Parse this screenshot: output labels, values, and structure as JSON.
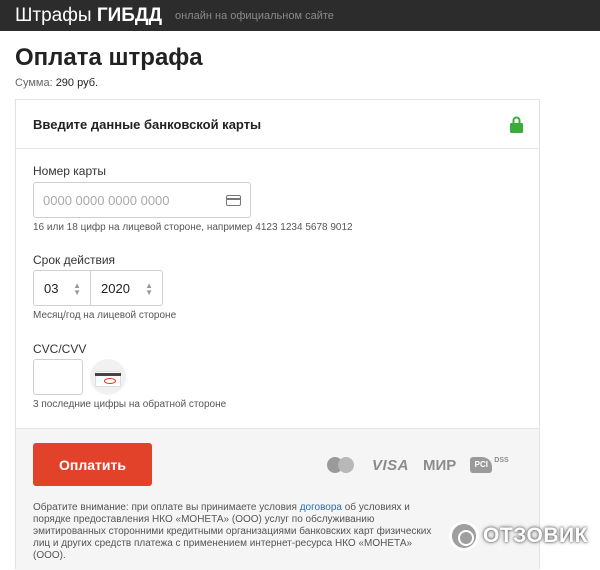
{
  "topbar": {
    "brand_light": "Штрафы",
    "brand_bold": "ГИБДД",
    "tagline": "онлайн на официальном сайте"
  },
  "page": {
    "title": "Оплата штрафа",
    "sum_label": "Сумма:",
    "sum_value": "290 руб."
  },
  "card_form": {
    "header": "Введите данные банковской карты",
    "lock_icon": "lock-icon",
    "card_number": {
      "label": "Номер карты",
      "placeholder": "0000 0000 0000 0000",
      "hint": "16 или 18 цифр на лицевой стороне, например 4123 1234 5678 9012"
    },
    "expiry": {
      "label": "Срок действия",
      "month": "03",
      "year": "2020",
      "hint": "Месяц/год на лицевой стороне"
    },
    "cvc": {
      "label": "CVC/CVV",
      "hint": "3 последние цифры на обратной стороне"
    }
  },
  "payment": {
    "pay_button": "Оплатить",
    "logos": {
      "visa": "VISA",
      "mir": "МИР",
      "pci": "PCI",
      "dss": "DSS"
    },
    "notice_before": "Обратите внимание: при оплате вы принимаете условия ",
    "notice_link": "договора",
    "notice_after": " об условиях и порядке предоставления НКО «МОНЕТА» (ООО) услуг по обслуживанию эмитированных сторонними кредитными организациями банковских карт физических лиц и других средств платежа с применением интернет-ресурса НКО «МОНЕТА» (ООО)."
  },
  "watermark": {
    "text": "ОТЗОВИК"
  },
  "colors": {
    "accent": "#e3422a",
    "lock": "#3bab3a",
    "link": "#1f6fb4",
    "topbar": "#2c2c2c"
  }
}
